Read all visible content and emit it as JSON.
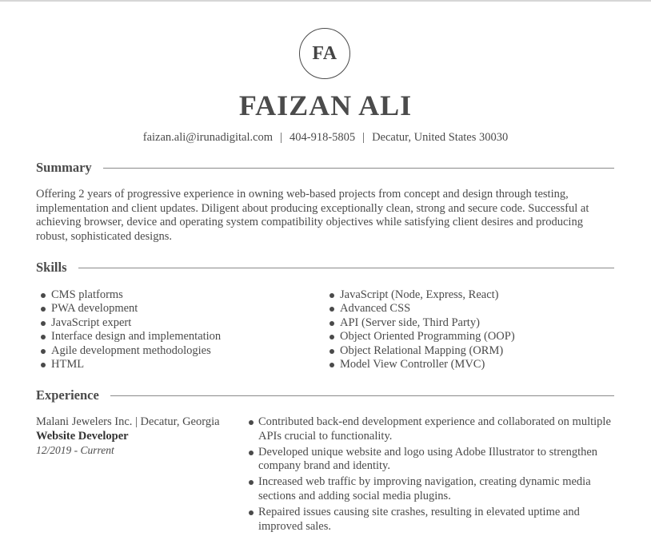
{
  "monogram": "FA",
  "name": "FAIZAN ALI",
  "contact": {
    "email": "faizan.ali@irunadigital.com",
    "phone": "404-918-5805",
    "location": "Decatur, United States 30030",
    "separator": "|"
  },
  "summary": {
    "heading": "Summary",
    "text": "Offering 2 years of progressive experience in owning web-based projects from concept and design through testing, implementation and client updates. Diligent about producing exceptionally clean, strong and secure code. Successful at achieving browser, device and operating system compatibility objectives while satisfying client desires and producing robust, sophisticated designs."
  },
  "skills": {
    "heading": "Skills",
    "left": [
      "CMS platforms",
      "PWA development",
      "JavaScript expert",
      "Interface design and implementation",
      "Agile development methodologies",
      "HTML"
    ],
    "right": [
      "JavaScript (Node, Express, React)",
      "Advanced CSS",
      "API (Server side, Third Party)",
      "Object Oriented Programming (OOP)",
      "Object Relational Mapping (ORM)",
      "Model View Controller (MVC)"
    ]
  },
  "experience": {
    "heading": "Experience",
    "jobs": [
      {
        "company_line": "Malani Jewelers Inc. | Decatur, Georgia",
        "title": "Website Developer",
        "dates": "12/2019 - Current",
        "bullets": [
          "Contributed back-end development experience and collaborated on multiple APIs crucial to functionality.",
          "Developed unique website and logo using Adobe Illustrator to strengthen company brand and identity.",
          "Increased web traffic by improving navigation, creating dynamic media sections and adding social media plugins.",
          "Repaired issues causing site crashes, resulting in elevated uptime and improved sales."
        ]
      }
    ]
  }
}
